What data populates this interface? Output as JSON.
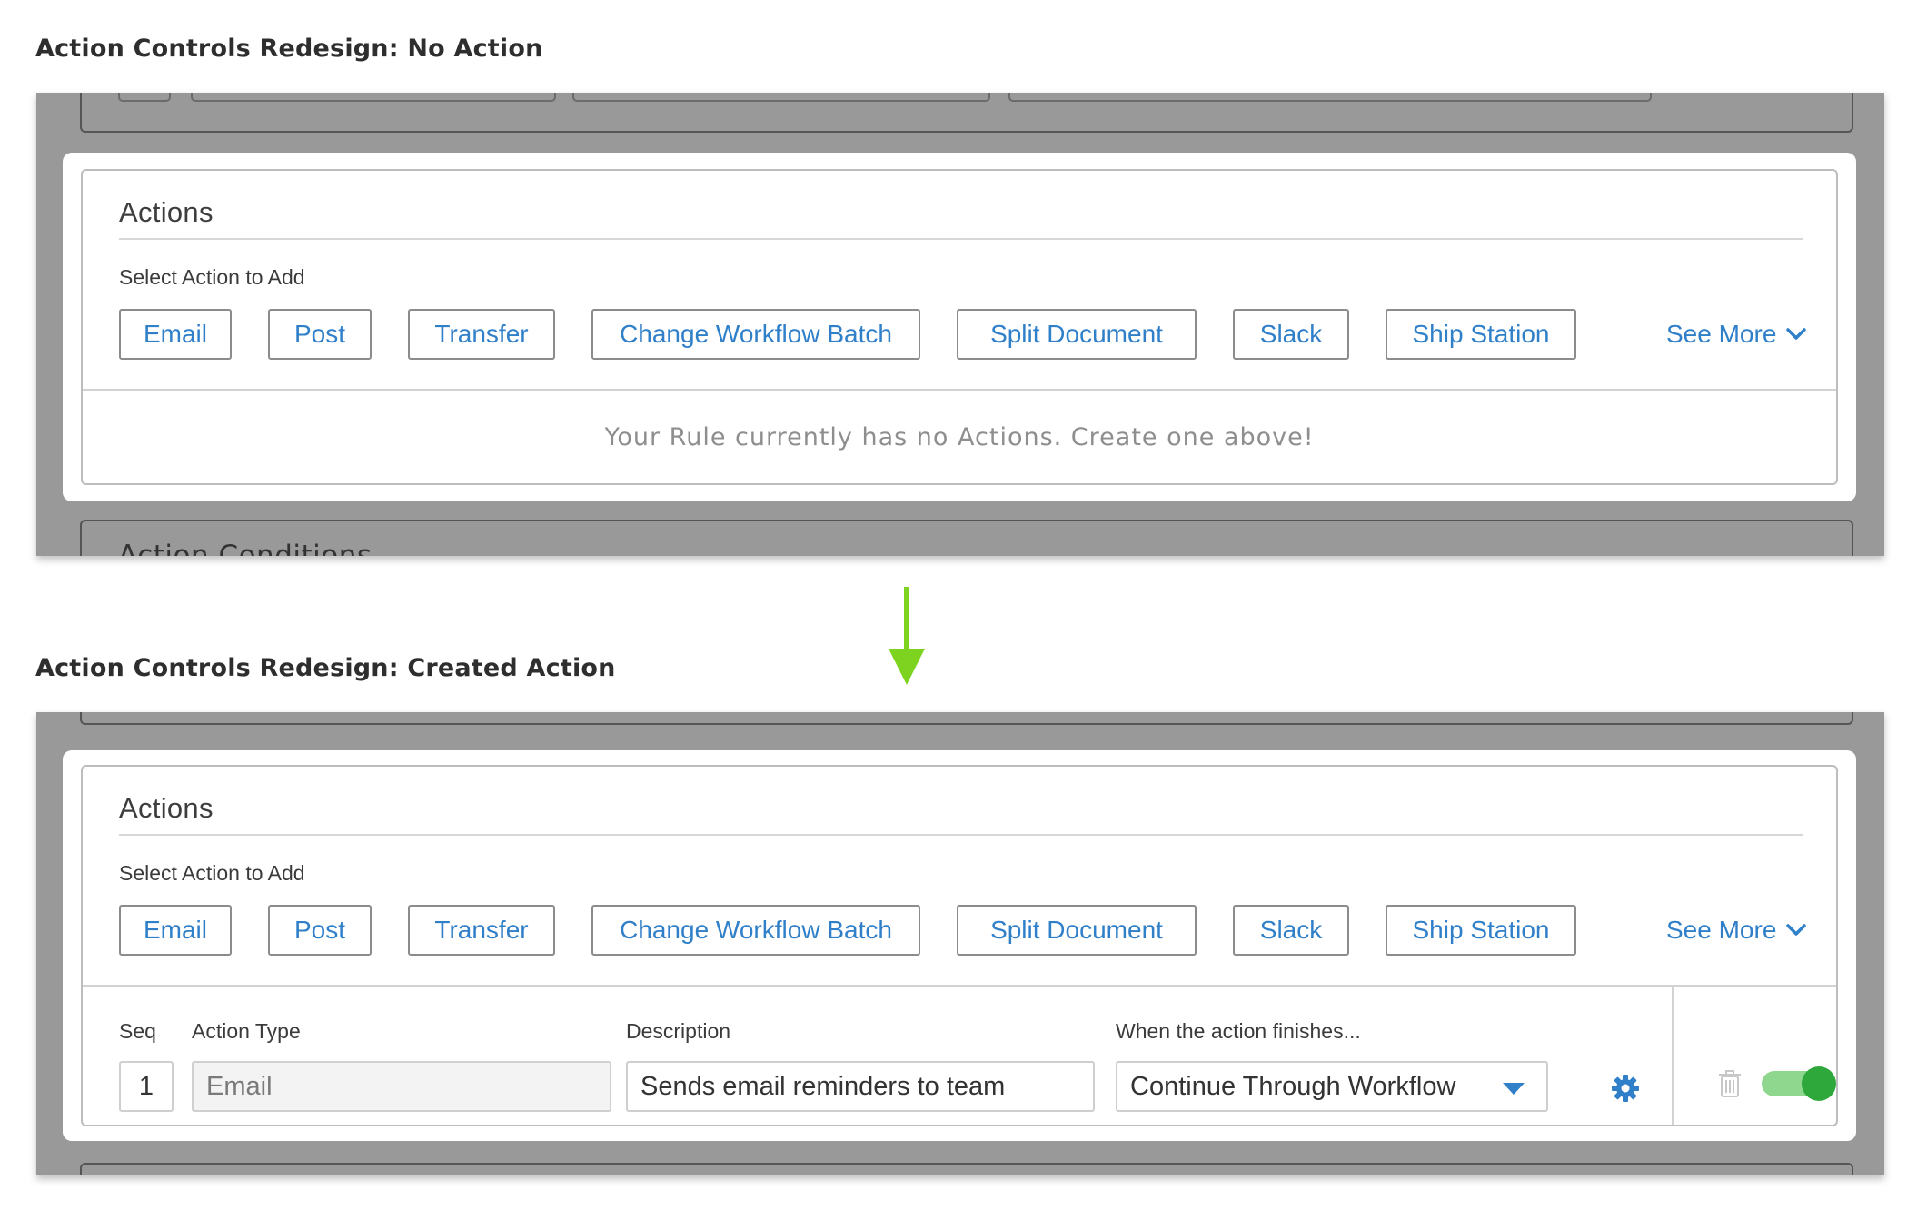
{
  "sections": [
    {
      "title": "Action Controls Redesign: No Action",
      "actions_heading": "Actions",
      "select_label": "Select Action to Add",
      "buttons": [
        "Email",
        "Post",
        "Transfer",
        "Change Workflow Batch",
        "Split Document",
        "Slack",
        "Ship Station"
      ],
      "see_more": "See More",
      "empty_message": "Your Rule currently has no Actions. Create one above!",
      "below_panel_title": "Action Conditions"
    },
    {
      "title": "Action Controls Redesign: Created Action",
      "actions_heading": "Actions",
      "select_label": "Select Action to Add",
      "buttons": [
        "Email",
        "Post",
        "Transfer",
        "Change Workflow Batch",
        "Split Document",
        "Slack",
        "Ship Station"
      ],
      "see_more": "See More",
      "row": {
        "seq_label": "Seq",
        "type_label": "Action Type",
        "description_label": "Description",
        "finish_label": "When the action finishes...",
        "seq_value": "1",
        "type_value": "Email",
        "description_value": "Sends email reminders to team",
        "finish_value": "Continue Through Workflow",
        "enabled": true
      }
    }
  ],
  "colors": {
    "link_blue": "#2f7fc9",
    "arrow_green": "#7ed321",
    "toggle_on": "#2ea83b",
    "overlay_gray": "#999999"
  },
  "icons": [
    "chevron-down-icon",
    "arrow-down-icon",
    "gear-icon",
    "trash-icon",
    "toggle-switch"
  ]
}
